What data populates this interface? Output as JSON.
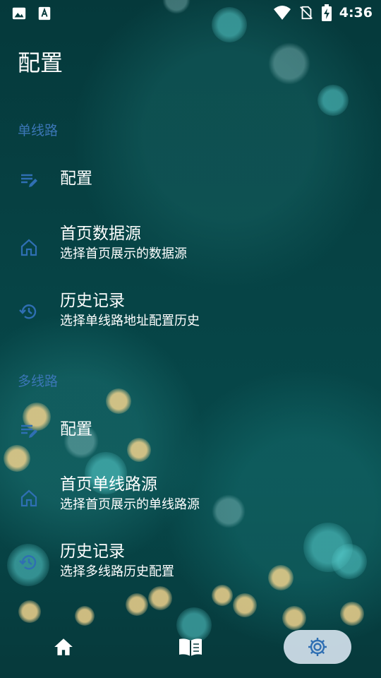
{
  "status_bar": {
    "time": "4:36",
    "icons": [
      "image-icon",
      "text-icon",
      "wifi-icon",
      "no-sim-icon",
      "battery-charging-icon"
    ]
  },
  "page": {
    "title": "配置"
  },
  "sections": [
    {
      "header": "单线路",
      "items": [
        {
          "icon": "edit-list-icon",
          "title": "配置",
          "subtitle": ""
        },
        {
          "icon": "home-icon",
          "title": "首页数据源",
          "subtitle": "选择首页展示的数据源"
        },
        {
          "icon": "history-icon",
          "title": "历史记录",
          "subtitle": "选择单线路地址配置历史"
        }
      ]
    },
    {
      "header": "多线路",
      "items": [
        {
          "icon": "edit-list-icon",
          "title": "配置",
          "subtitle": ""
        },
        {
          "icon": "home-icon",
          "title": "首页单线路源",
          "subtitle": "选择首页展示的单线路源"
        },
        {
          "icon": "history-icon",
          "title": "历史记录",
          "subtitle": "选择多线路历史配置"
        }
      ]
    }
  ],
  "bottom_nav": {
    "items": [
      {
        "icon": "home-icon",
        "selected": false
      },
      {
        "icon": "book-icon",
        "selected": false
      },
      {
        "icon": "settings-icon",
        "selected": true
      }
    ]
  },
  "colors": {
    "section_header": "#3b76b6",
    "icon": "#2f6fb3",
    "nav_pill": "#d2e1eb"
  }
}
